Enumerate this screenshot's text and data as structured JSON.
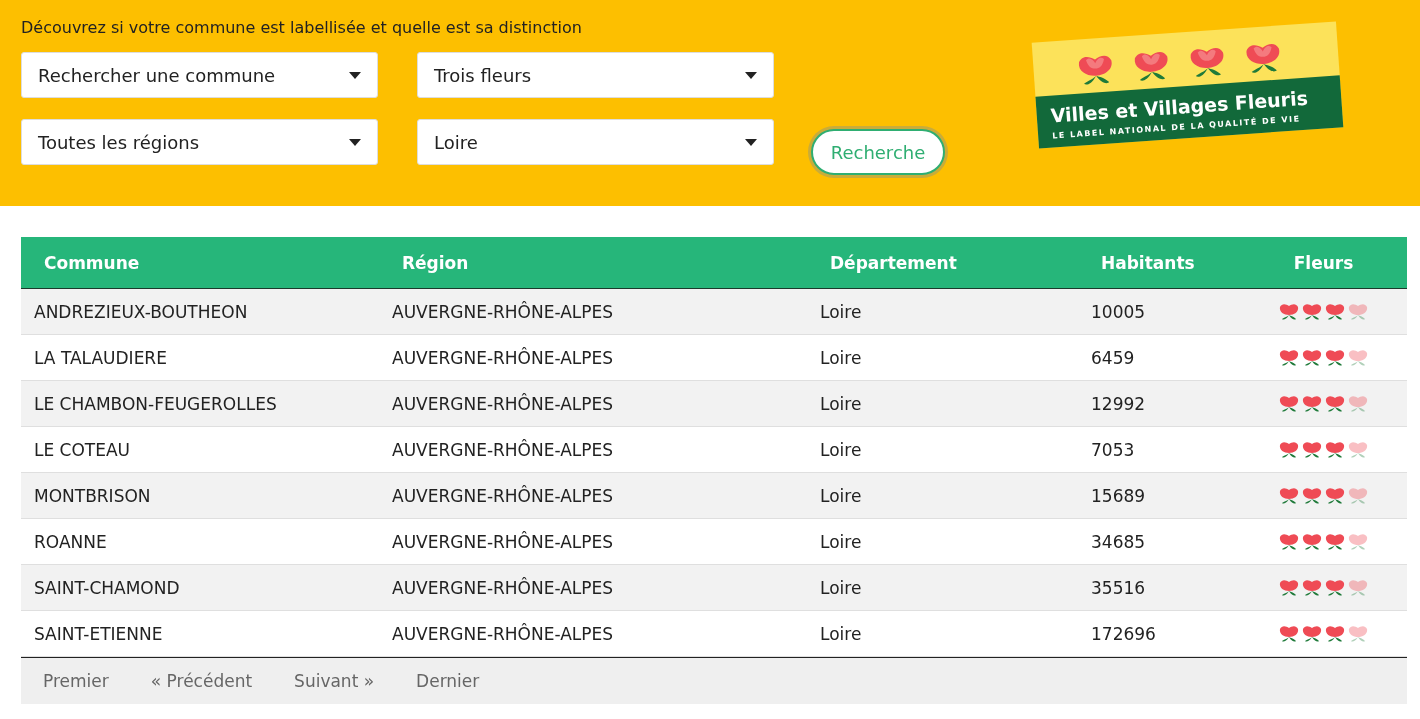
{
  "search_panel": {
    "intro": "Découvrez si votre commune est labellisée et quelle est sa distinction",
    "filters": [
      {
        "value": "Rechercher une commune"
      },
      {
        "value": "Trois fleurs"
      },
      {
        "value": "Toutes les régions"
      },
      {
        "value": "Loire"
      }
    ],
    "button": "Recherche"
  },
  "logo": {
    "title": "Villes et Villages Fleuris",
    "subtitle": "LE LABEL NATIONAL DE LA QUALITÉ DE VIE"
  },
  "table": {
    "columns": [
      "Commune",
      "Région",
      "Département",
      "Habitants",
      "Fleurs"
    ],
    "rows": [
      {
        "commune": "ANDREZIEUX-BOUTHEON",
        "region": "AUVERGNE-RHÔNE-ALPES",
        "departement": "Loire",
        "habitants": "10005",
        "stars": 3
      },
      {
        "commune": "LA TALAUDIERE",
        "region": "AUVERGNE-RHÔNE-ALPES",
        "departement": "Loire",
        "habitants": "6459",
        "stars": 3
      },
      {
        "commune": "LE CHAMBON-FEUGEROLLES",
        "region": "AUVERGNE-RHÔNE-ALPES",
        "departement": "Loire",
        "habitants": "12992",
        "stars": 3
      },
      {
        "commune": "LE COTEAU",
        "region": "AUVERGNE-RHÔNE-ALPES",
        "departement": "Loire",
        "habitants": "7053",
        "stars": 3
      },
      {
        "commune": "MONTBRISON",
        "region": "AUVERGNE-RHÔNE-ALPES",
        "departement": "Loire",
        "habitants": "15689",
        "stars": 3
      },
      {
        "commune": "ROANNE",
        "region": "AUVERGNE-RHÔNE-ALPES",
        "departement": "Loire",
        "habitants": "34685",
        "stars": 3
      },
      {
        "commune": "SAINT-CHAMOND",
        "region": "AUVERGNE-RHÔNE-ALPES",
        "departement": "Loire",
        "habitants": "35516",
        "stars": 3
      },
      {
        "commune": "SAINT-ETIENNE",
        "region": "AUVERGNE-RHÔNE-ALPES",
        "departement": "Loire",
        "habitants": "172696",
        "stars": 3
      }
    ]
  },
  "pagination": [
    "Premier",
    "« Précédent",
    "Suivant »",
    "Dernier"
  ]
}
